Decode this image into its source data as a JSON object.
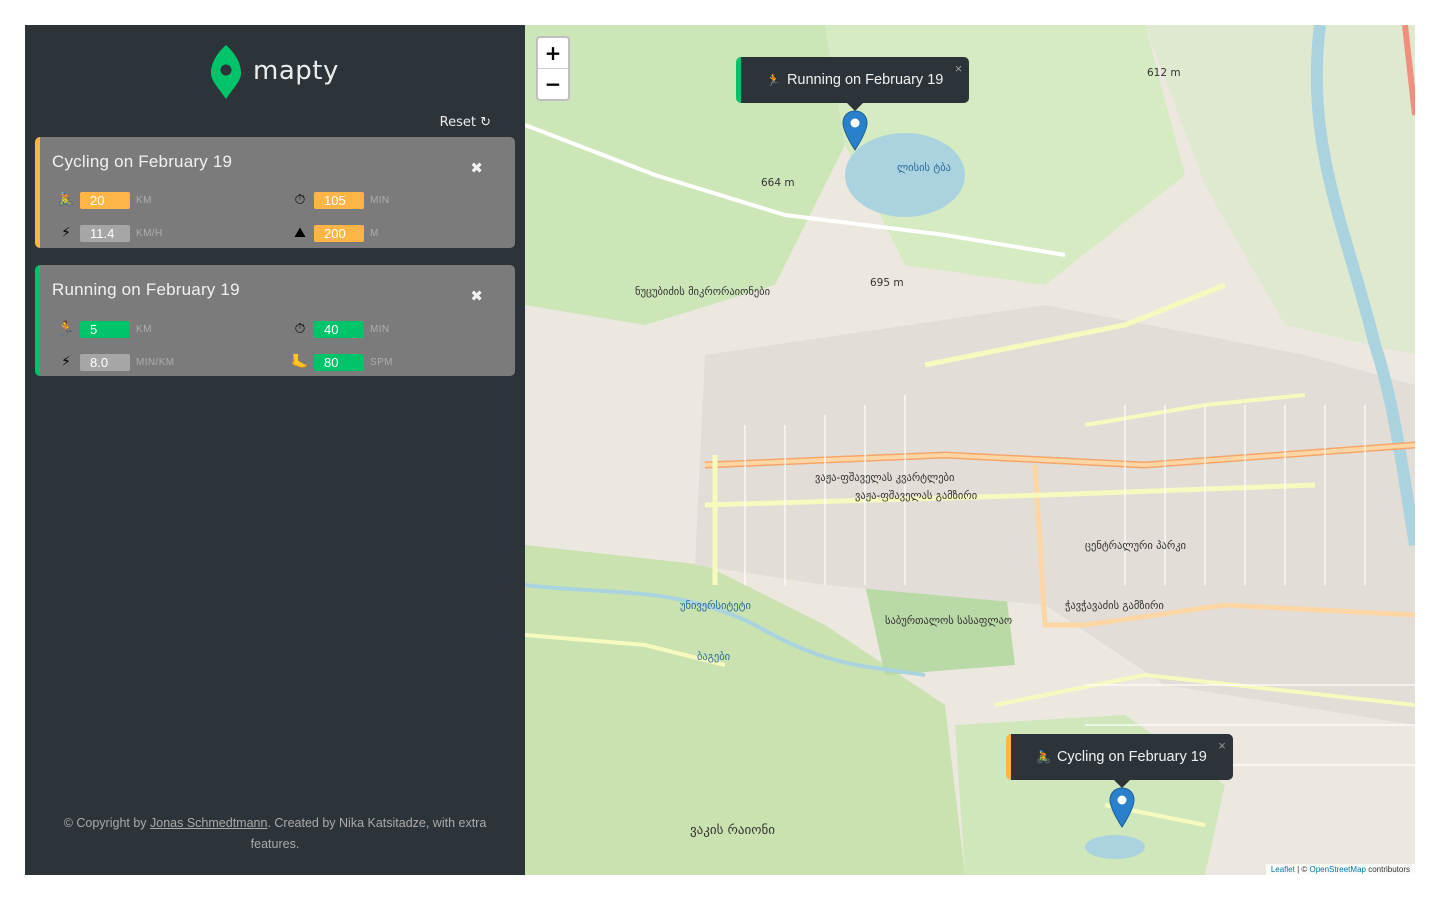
{
  "logo": {
    "text": "mapty"
  },
  "sidebar": {
    "reset_label": "Reset ↻"
  },
  "workouts": [
    {
      "type": "cycling",
      "title": "Cycling on February 19",
      "close": "✖",
      "distance": {
        "icon": "🚴",
        "value": "20",
        "unit": "KM"
      },
      "duration": {
        "icon": "⏱",
        "value": "105",
        "unit": "MIN"
      },
      "speed": {
        "icon": "⚡",
        "value": "11.4",
        "unit": "KM/H"
      },
      "elevation": {
        "icon": "⛰",
        "value": "200",
        "unit": "M"
      }
    },
    {
      "type": "running",
      "title": "Running on February 19",
      "close": "✖",
      "distance": {
        "icon": "🏃",
        "value": "5",
        "unit": "KM"
      },
      "duration": {
        "icon": "⏱",
        "value": "40",
        "unit": "MIN"
      },
      "pace": {
        "icon": "⚡",
        "value": "8.0",
        "unit": "MIN/KM"
      },
      "cadence": {
        "icon": "🦶",
        "value": "80",
        "unit": "SPM"
      }
    }
  ],
  "footer": {
    "prefix": "© Copyright by ",
    "link": "Jonas Schmedtmann",
    "suffix": ". Created by Nika Katsitadze, with extra features."
  },
  "map": {
    "zoom_in": "+",
    "zoom_out": "−",
    "popups": [
      {
        "icon": "🏃",
        "text": "Running on February 19",
        "close": "×"
      },
      {
        "icon": "🚴",
        "text": "Cycling on February 19",
        "close": "×"
      }
    ],
    "attribution": {
      "leaflet": "Leaflet",
      "sep": " | © ",
      "osm": "OpenStreetMap",
      "suffix": " contributors"
    },
    "labels": {
      "lake": "ლისის ტბა",
      "district1": "ნუცუბიძის მიკრორაიონები",
      "district2": "ვაჟა-ფშაველას კვარტლები",
      "park": "ცენტრალური პარკი",
      "uni": "უნივერსიტეტი",
      "bagebi": "ბაგები",
      "vake": "ვაკის რაიონი",
      "cemetery": "საბურთალოს სასაფლაო",
      "street1": "ვაჟა-ფშაველას გამზირი",
      "street2": "ჭავჭავაძის გამზირი",
      "elev1": "664 m",
      "elev2": "695 m",
      "elev3": "612 m"
    }
  },
  "colors": {
    "cycling": "#ffb545",
    "running": "#00c46a",
    "dark": "#2d3439"
  }
}
